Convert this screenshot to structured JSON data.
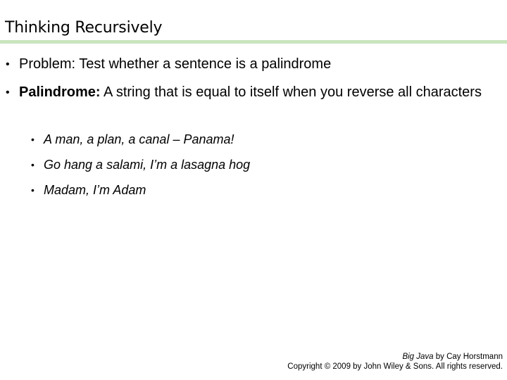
{
  "slide": {
    "title": "Thinking Recursively",
    "divider_color": "#c9e4bc",
    "bullets": [
      {
        "marker": "•",
        "text": "Problem: Test whether a sentence is a palindrome"
      },
      {
        "marker": "•",
        "term": "Palindrome:",
        "text": " A string that is equal to itself when you reverse all characters",
        "sub_bullets": [
          {
            "marker": "•",
            "text": "A man, a plan, a canal – Panama!"
          },
          {
            "marker": "•",
            "text": "Go hang a salami, I’m a lasagna hog"
          },
          {
            "marker": "•",
            "text": "Madam, I’m Adam"
          }
        ]
      }
    ],
    "footer": {
      "book_title": "Big Java",
      "byline": " by Cay Horstmann",
      "copyright": "Copyright © 2009 by John Wiley & Sons.  All rights reserved."
    }
  }
}
